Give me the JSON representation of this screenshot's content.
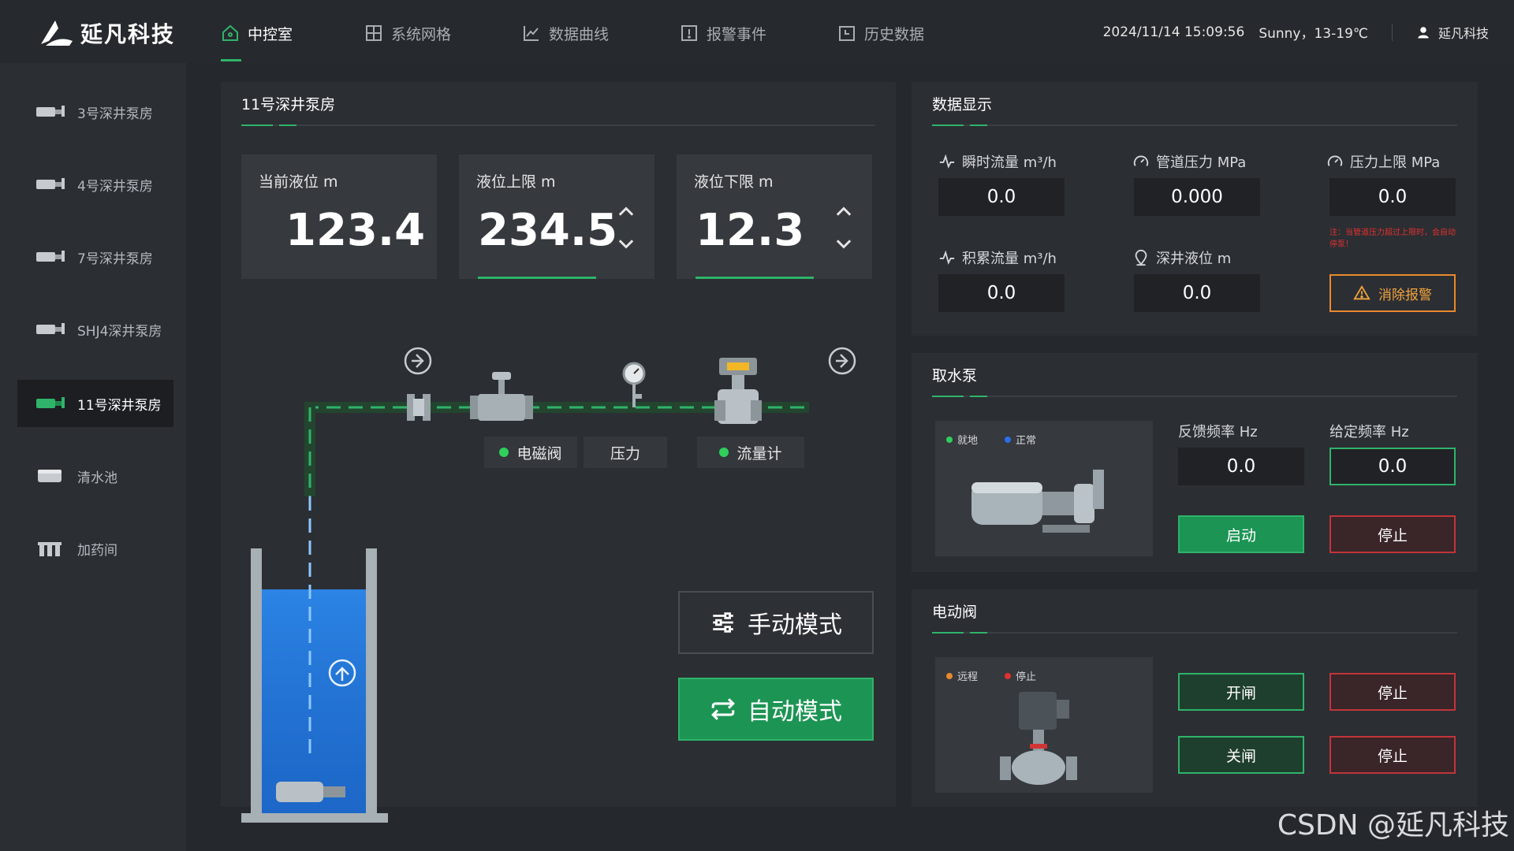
{
  "app": {
    "logo_text": "延凡科技"
  },
  "nav": [
    {
      "label": "中控室",
      "icon": "home-icon",
      "active": true
    },
    {
      "label": "系统网格",
      "icon": "grid-icon",
      "active": false
    },
    {
      "label": "数据曲线",
      "icon": "chart-line-icon",
      "active": false
    },
    {
      "label": "报警事件",
      "icon": "alert-box-icon",
      "active": false
    },
    {
      "label": "历史数据",
      "icon": "history-icon",
      "active": false
    }
  ],
  "header": {
    "datetime": "2024/11/14  15:09:56",
    "weather": "Sunny，13-19℃",
    "user": "延凡科技"
  },
  "sidebar": {
    "items": [
      {
        "label": "3号深井泵房",
        "active": false
      },
      {
        "label": "4号深井泵房",
        "active": false
      },
      {
        "label": "7号深井泵房",
        "active": false
      },
      {
        "label": "SHJ4深井泵房",
        "active": false
      },
      {
        "label": "11号深井泵房",
        "active": true
      },
      {
        "label": "清水池",
        "active": false
      },
      {
        "label": "加药间",
        "active": false
      }
    ]
  },
  "main": {
    "title": "11号深井泵房",
    "cards": [
      {
        "label": "当前液位  m",
        "value": "123.4"
      },
      {
        "label": "液位上限  m",
        "value": "234.5"
      },
      {
        "label": "液位下限  m",
        "value": "12.3"
      }
    ],
    "pipe_labels": {
      "valve": "电磁阀",
      "pressure": "压力",
      "flowmeter": "流量计"
    },
    "modes": {
      "manual": "手动模式",
      "auto": "自动模式"
    }
  },
  "data_display": {
    "title": "数据显示",
    "instant_flow": {
      "label": "瞬时流量  m³/h",
      "value": "0.0"
    },
    "pipe_pressure": {
      "label": "管道压力  MPa",
      "value": "0.000"
    },
    "pressure_limit": {
      "label": "压力上限  MPa",
      "value": "0.0"
    },
    "total_flow": {
      "label": "积累流量  m³/h",
      "value": "0.0"
    },
    "well_level": {
      "label": "深井液位  m",
      "value": "0.0"
    },
    "warning_text": "注：当管道压力超过上限时，会自动停泵！",
    "clear_alarm": "消除报警"
  },
  "pump": {
    "title": "取水泵",
    "status_local": "就地",
    "status_normal": "正常",
    "feedback_label": "反馈频率  Hz",
    "feedback_value": "0.0",
    "setpoint_label": "给定频率  Hz",
    "setpoint_value": "0.0",
    "start": "启动",
    "stop": "停止"
  },
  "valve": {
    "title": "电动阀",
    "status_remote": "远程",
    "status_stop": "停止",
    "open": "开闸",
    "stop1": "停止",
    "close": "关闸",
    "stop2": "停止"
  },
  "colors": {
    "accent": "#2fb36a",
    "danger": "#c0353a",
    "warning": "#e8892c",
    "water": "#1f73d4"
  },
  "watermark": "CSDN @延凡科技"
}
